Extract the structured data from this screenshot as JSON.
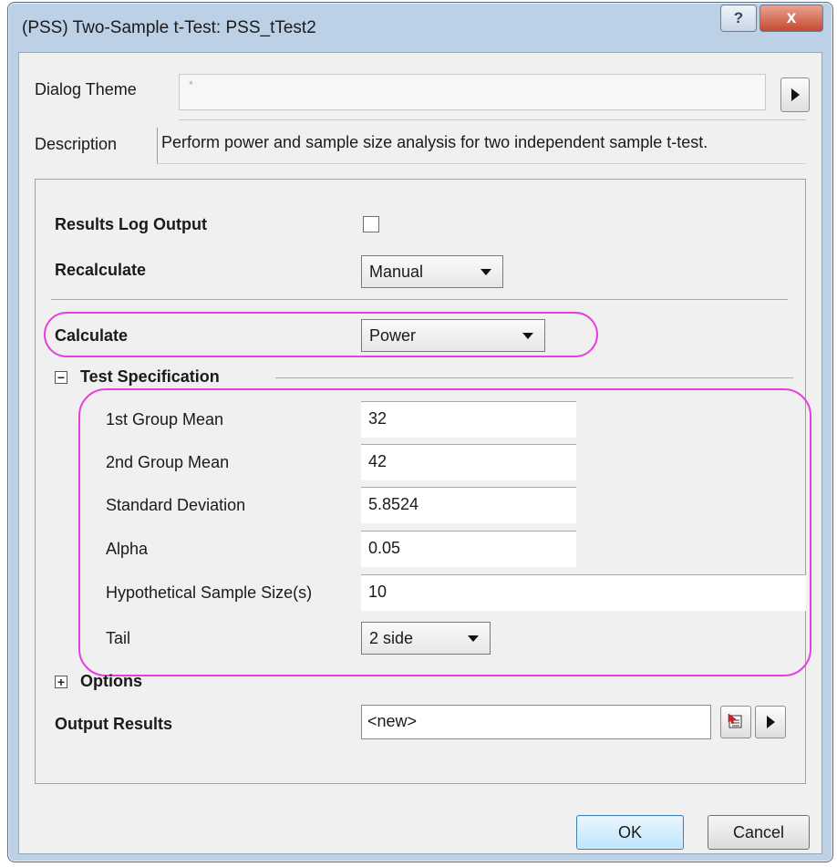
{
  "window": {
    "title": "(PSS) Two-Sample t-Test: PSS_tTest2",
    "help_glyph": "?",
    "close_glyph": "x"
  },
  "dialog_theme": {
    "label": "Dialog Theme",
    "value": "*"
  },
  "description": {
    "label": "Description",
    "text": "Perform power and sample size analysis for two independent sample t-test."
  },
  "settings": {
    "results_log_output_label": "Results Log Output",
    "results_log_output_checked": false,
    "recalculate_label": "Recalculate",
    "recalculate_value": "Manual",
    "calculate_label": "Calculate",
    "calculate_value": "Power"
  },
  "test_spec": {
    "header": "Test Specification",
    "expander": "−",
    "rows": [
      {
        "label": "1st Group Mean",
        "value": "32"
      },
      {
        "label": "2nd Group Mean",
        "value": "42"
      },
      {
        "label": "Standard Deviation",
        "value": "5.8524"
      },
      {
        "label": "Alpha",
        "value": "0.05"
      },
      {
        "label": "Hypothetical Sample Size(s)",
        "value": "10"
      }
    ],
    "tail_label": "Tail",
    "tail_value": "2 side"
  },
  "options": {
    "header": "Options",
    "expander": "+"
  },
  "output_results": {
    "label": "Output Results",
    "value": "<new>"
  },
  "buttons": {
    "ok": "OK",
    "cancel": "Cancel"
  },
  "colors": {
    "highlight": "#e83ee0",
    "title_bar": "#bcd0e6",
    "close_button": "#c6492d"
  }
}
